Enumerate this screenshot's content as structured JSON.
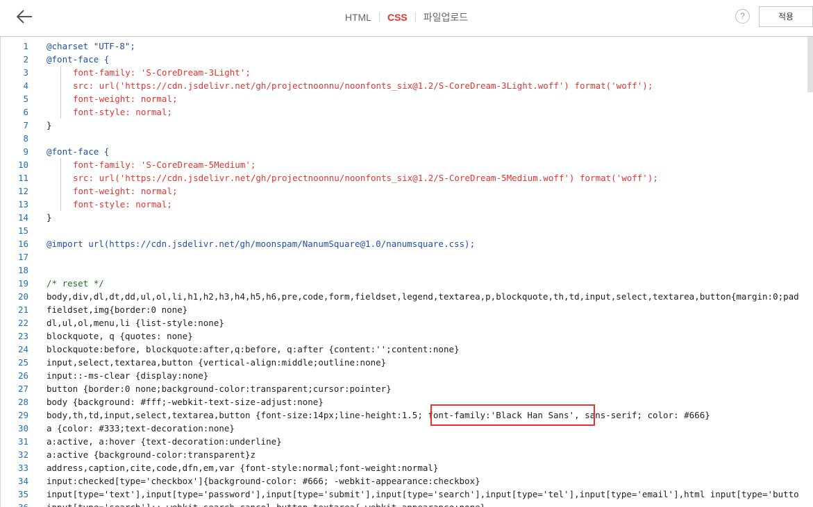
{
  "header": {
    "tabs": [
      {
        "label": "HTML",
        "active": false
      },
      {
        "label": "CSS",
        "active": true
      },
      {
        "label": "파일업로드",
        "active": false
      }
    ],
    "help_label": "?",
    "apply_label": "적용"
  },
  "colors": {
    "accent": "#e3342f",
    "keyword": "#1f4db0",
    "string": "#a31515",
    "comment": "#1f6f1f",
    "line_number": "#1f6fb5"
  },
  "editor": {
    "lines": [
      {
        "n": "1",
        "text": "@charset \"UTF-8\";"
      },
      {
        "n": "2",
        "text": "@font-face {"
      },
      {
        "n": "3",
        "text": "font-family: 'S-CoreDream-3Light';"
      },
      {
        "n": "4",
        "text": "src: url('https://cdn.jsdelivr.net/gh/projectnoonnu/noonfonts_six@1.2/S-CoreDream-3Light.woff') format('woff');"
      },
      {
        "n": "5",
        "text": "font-weight: normal;"
      },
      {
        "n": "6",
        "text": "font-style: normal;"
      },
      {
        "n": "7",
        "text": "}"
      },
      {
        "n": "8",
        "text": ""
      },
      {
        "n": "9",
        "text": "@font-face {"
      },
      {
        "n": "10",
        "text": "font-family: 'S-CoreDream-5Medium';"
      },
      {
        "n": "11",
        "text": "src: url('https://cdn.jsdelivr.net/gh/projectnoonnu/noonfonts_six@1.2/S-CoreDream-5Medium.woff') format('woff');"
      },
      {
        "n": "12",
        "text": "font-weight: normal;"
      },
      {
        "n": "13",
        "text": "font-style: normal;"
      },
      {
        "n": "14",
        "text": "}"
      },
      {
        "n": "15",
        "text": ""
      },
      {
        "n": "16",
        "text": "@import url(https://cdn.jsdelivr.net/gh/moonspam/NanumSquare@1.0/nanumsquare.css);"
      },
      {
        "n": "17",
        "text": ""
      },
      {
        "n": "18",
        "text": ""
      },
      {
        "n": "19",
        "text": "/* reset */"
      },
      {
        "n": "20",
        "text": "body,div,dl,dt,dd,ul,ol,li,h1,h2,h3,h4,h5,h6,pre,code,form,fieldset,legend,textarea,p,blockquote,th,td,input,select,textarea,button{margin:0;pad"
      },
      {
        "n": "21",
        "text": "fieldset,img{border:0 none}"
      },
      {
        "n": "22",
        "text": "dl,ul,ol,menu,li {list-style:none}"
      },
      {
        "n": "23",
        "text": "blockquote, q {quotes: none}"
      },
      {
        "n": "24",
        "text": "blockquote:before, blockquote:after,q:before, q:after {content:'';content:none}"
      },
      {
        "n": "25",
        "text": "input,select,textarea,button {vertical-align:middle;outline:none}"
      },
      {
        "n": "26",
        "text": "input::-ms-clear {display:none}"
      },
      {
        "n": "27",
        "text": "button {border:0 none;background-color:transparent;cursor:pointer}"
      },
      {
        "n": "28",
        "text": "body {background: #fff;-webkit-text-size-adjust:none}"
      },
      {
        "n": "29",
        "text": "body,th,td,input,select,textarea,button {font-size:14px;line-height:1.5; font-family:'Black Han Sans', sans-serif; color: #666}"
      },
      {
        "n": "30",
        "text": "a {color: #333;text-decoration:none}"
      },
      {
        "n": "31",
        "text": "a:active, a:hover {text-decoration:underline}"
      },
      {
        "n": "32",
        "text": "a:active {background-color:transparent}z"
      },
      {
        "n": "33",
        "text": "address,caption,cite,code,dfn,em,var {font-style:normal;font-weight:normal}"
      },
      {
        "n": "34",
        "text": "input:checked[type='checkbox']{background-color: #666; -webkit-appearance:checkbox}"
      },
      {
        "n": "35",
        "text": "input[type='text'],input[type='password'],input[type='submit'],input[type='search'],input[type='tel'],input[type='email'],html input[type='butto"
      },
      {
        "n": "36",
        "text": "input[type='search']::-webkit-search-cancel-button,textarea{-webkit-appearance:none}"
      }
    ]
  }
}
